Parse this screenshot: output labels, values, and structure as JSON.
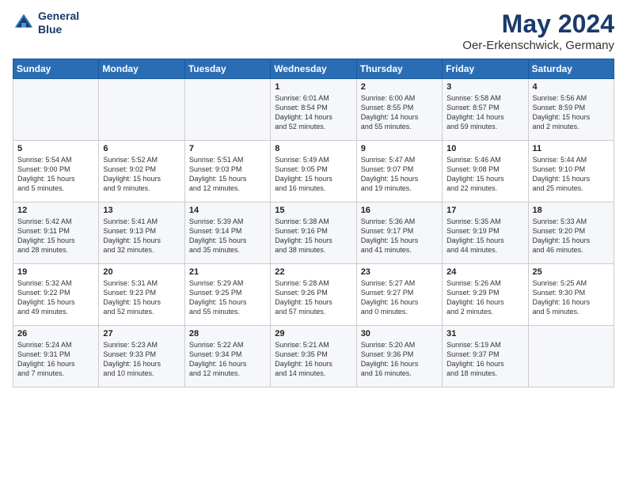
{
  "header": {
    "logo_line1": "General",
    "logo_line2": "Blue",
    "title": "May 2024",
    "subtitle": "Oer-Erkenschwick, Germany"
  },
  "days_of_week": [
    "Sunday",
    "Monday",
    "Tuesday",
    "Wednesday",
    "Thursday",
    "Friday",
    "Saturday"
  ],
  "weeks": [
    [
      {
        "day": "",
        "content": ""
      },
      {
        "day": "",
        "content": ""
      },
      {
        "day": "",
        "content": ""
      },
      {
        "day": "1",
        "content": "Sunrise: 6:01 AM\nSunset: 8:54 PM\nDaylight: 14 hours\nand 52 minutes."
      },
      {
        "day": "2",
        "content": "Sunrise: 6:00 AM\nSunset: 8:55 PM\nDaylight: 14 hours\nand 55 minutes."
      },
      {
        "day": "3",
        "content": "Sunrise: 5:58 AM\nSunset: 8:57 PM\nDaylight: 14 hours\nand 59 minutes."
      },
      {
        "day": "4",
        "content": "Sunrise: 5:56 AM\nSunset: 8:59 PM\nDaylight: 15 hours\nand 2 minutes."
      }
    ],
    [
      {
        "day": "5",
        "content": "Sunrise: 5:54 AM\nSunset: 9:00 PM\nDaylight: 15 hours\nand 5 minutes."
      },
      {
        "day": "6",
        "content": "Sunrise: 5:52 AM\nSunset: 9:02 PM\nDaylight: 15 hours\nand 9 minutes."
      },
      {
        "day": "7",
        "content": "Sunrise: 5:51 AM\nSunset: 9:03 PM\nDaylight: 15 hours\nand 12 minutes."
      },
      {
        "day": "8",
        "content": "Sunrise: 5:49 AM\nSunset: 9:05 PM\nDaylight: 15 hours\nand 16 minutes."
      },
      {
        "day": "9",
        "content": "Sunrise: 5:47 AM\nSunset: 9:07 PM\nDaylight: 15 hours\nand 19 minutes."
      },
      {
        "day": "10",
        "content": "Sunrise: 5:46 AM\nSunset: 9:08 PM\nDaylight: 15 hours\nand 22 minutes."
      },
      {
        "day": "11",
        "content": "Sunrise: 5:44 AM\nSunset: 9:10 PM\nDaylight: 15 hours\nand 25 minutes."
      }
    ],
    [
      {
        "day": "12",
        "content": "Sunrise: 5:42 AM\nSunset: 9:11 PM\nDaylight: 15 hours\nand 28 minutes."
      },
      {
        "day": "13",
        "content": "Sunrise: 5:41 AM\nSunset: 9:13 PM\nDaylight: 15 hours\nand 32 minutes."
      },
      {
        "day": "14",
        "content": "Sunrise: 5:39 AM\nSunset: 9:14 PM\nDaylight: 15 hours\nand 35 minutes."
      },
      {
        "day": "15",
        "content": "Sunrise: 5:38 AM\nSunset: 9:16 PM\nDaylight: 15 hours\nand 38 minutes."
      },
      {
        "day": "16",
        "content": "Sunrise: 5:36 AM\nSunset: 9:17 PM\nDaylight: 15 hours\nand 41 minutes."
      },
      {
        "day": "17",
        "content": "Sunrise: 5:35 AM\nSunset: 9:19 PM\nDaylight: 15 hours\nand 44 minutes."
      },
      {
        "day": "18",
        "content": "Sunrise: 5:33 AM\nSunset: 9:20 PM\nDaylight: 15 hours\nand 46 minutes."
      }
    ],
    [
      {
        "day": "19",
        "content": "Sunrise: 5:32 AM\nSunset: 9:22 PM\nDaylight: 15 hours\nand 49 minutes."
      },
      {
        "day": "20",
        "content": "Sunrise: 5:31 AM\nSunset: 9:23 PM\nDaylight: 15 hours\nand 52 minutes."
      },
      {
        "day": "21",
        "content": "Sunrise: 5:29 AM\nSunset: 9:25 PM\nDaylight: 15 hours\nand 55 minutes."
      },
      {
        "day": "22",
        "content": "Sunrise: 5:28 AM\nSunset: 9:26 PM\nDaylight: 15 hours\nand 57 minutes."
      },
      {
        "day": "23",
        "content": "Sunrise: 5:27 AM\nSunset: 9:27 PM\nDaylight: 16 hours\nand 0 minutes."
      },
      {
        "day": "24",
        "content": "Sunrise: 5:26 AM\nSunset: 9:29 PM\nDaylight: 16 hours\nand 2 minutes."
      },
      {
        "day": "25",
        "content": "Sunrise: 5:25 AM\nSunset: 9:30 PM\nDaylight: 16 hours\nand 5 minutes."
      }
    ],
    [
      {
        "day": "26",
        "content": "Sunrise: 5:24 AM\nSunset: 9:31 PM\nDaylight: 16 hours\nand 7 minutes."
      },
      {
        "day": "27",
        "content": "Sunrise: 5:23 AM\nSunset: 9:33 PM\nDaylight: 16 hours\nand 10 minutes."
      },
      {
        "day": "28",
        "content": "Sunrise: 5:22 AM\nSunset: 9:34 PM\nDaylight: 16 hours\nand 12 minutes."
      },
      {
        "day": "29",
        "content": "Sunrise: 5:21 AM\nSunset: 9:35 PM\nDaylight: 16 hours\nand 14 minutes."
      },
      {
        "day": "30",
        "content": "Sunrise: 5:20 AM\nSunset: 9:36 PM\nDaylight: 16 hours\nand 16 minutes."
      },
      {
        "day": "31",
        "content": "Sunrise: 5:19 AM\nSunset: 9:37 PM\nDaylight: 16 hours\nand 18 minutes."
      },
      {
        "day": "",
        "content": ""
      }
    ]
  ]
}
